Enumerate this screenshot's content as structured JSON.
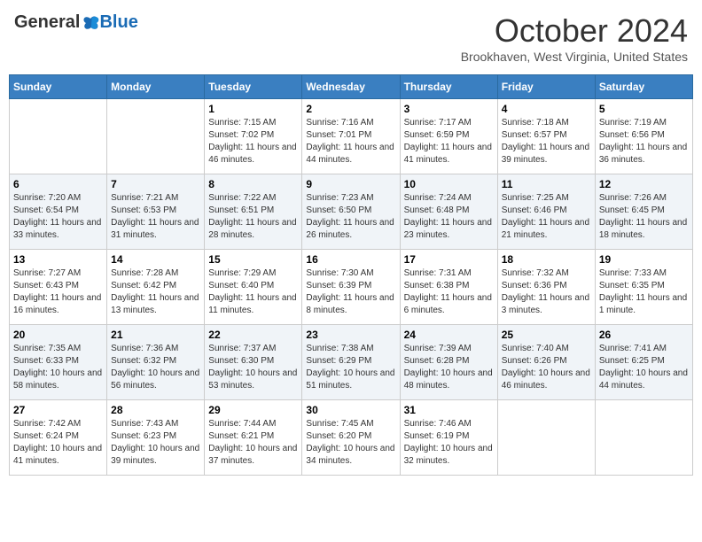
{
  "header": {
    "logo_general": "General",
    "logo_blue": "Blue",
    "month_title": "October 2024",
    "location": "Brookhaven, West Virginia, United States"
  },
  "days_of_week": [
    "Sunday",
    "Monday",
    "Tuesday",
    "Wednesday",
    "Thursday",
    "Friday",
    "Saturday"
  ],
  "weeks": [
    [
      {
        "day": "",
        "info": ""
      },
      {
        "day": "",
        "info": ""
      },
      {
        "day": "1",
        "info": "Sunrise: 7:15 AM\nSunset: 7:02 PM\nDaylight: 11 hours and 46 minutes."
      },
      {
        "day": "2",
        "info": "Sunrise: 7:16 AM\nSunset: 7:01 PM\nDaylight: 11 hours and 44 minutes."
      },
      {
        "day": "3",
        "info": "Sunrise: 7:17 AM\nSunset: 6:59 PM\nDaylight: 11 hours and 41 minutes."
      },
      {
        "day": "4",
        "info": "Sunrise: 7:18 AM\nSunset: 6:57 PM\nDaylight: 11 hours and 39 minutes."
      },
      {
        "day": "5",
        "info": "Sunrise: 7:19 AM\nSunset: 6:56 PM\nDaylight: 11 hours and 36 minutes."
      }
    ],
    [
      {
        "day": "6",
        "info": "Sunrise: 7:20 AM\nSunset: 6:54 PM\nDaylight: 11 hours and 33 minutes."
      },
      {
        "day": "7",
        "info": "Sunrise: 7:21 AM\nSunset: 6:53 PM\nDaylight: 11 hours and 31 minutes."
      },
      {
        "day": "8",
        "info": "Sunrise: 7:22 AM\nSunset: 6:51 PM\nDaylight: 11 hours and 28 minutes."
      },
      {
        "day": "9",
        "info": "Sunrise: 7:23 AM\nSunset: 6:50 PM\nDaylight: 11 hours and 26 minutes."
      },
      {
        "day": "10",
        "info": "Sunrise: 7:24 AM\nSunset: 6:48 PM\nDaylight: 11 hours and 23 minutes."
      },
      {
        "day": "11",
        "info": "Sunrise: 7:25 AM\nSunset: 6:46 PM\nDaylight: 11 hours and 21 minutes."
      },
      {
        "day": "12",
        "info": "Sunrise: 7:26 AM\nSunset: 6:45 PM\nDaylight: 11 hours and 18 minutes."
      }
    ],
    [
      {
        "day": "13",
        "info": "Sunrise: 7:27 AM\nSunset: 6:43 PM\nDaylight: 11 hours and 16 minutes."
      },
      {
        "day": "14",
        "info": "Sunrise: 7:28 AM\nSunset: 6:42 PM\nDaylight: 11 hours and 13 minutes."
      },
      {
        "day": "15",
        "info": "Sunrise: 7:29 AM\nSunset: 6:40 PM\nDaylight: 11 hours and 11 minutes."
      },
      {
        "day": "16",
        "info": "Sunrise: 7:30 AM\nSunset: 6:39 PM\nDaylight: 11 hours and 8 minutes."
      },
      {
        "day": "17",
        "info": "Sunrise: 7:31 AM\nSunset: 6:38 PM\nDaylight: 11 hours and 6 minutes."
      },
      {
        "day": "18",
        "info": "Sunrise: 7:32 AM\nSunset: 6:36 PM\nDaylight: 11 hours and 3 minutes."
      },
      {
        "day": "19",
        "info": "Sunrise: 7:33 AM\nSunset: 6:35 PM\nDaylight: 11 hours and 1 minute."
      }
    ],
    [
      {
        "day": "20",
        "info": "Sunrise: 7:35 AM\nSunset: 6:33 PM\nDaylight: 10 hours and 58 minutes."
      },
      {
        "day": "21",
        "info": "Sunrise: 7:36 AM\nSunset: 6:32 PM\nDaylight: 10 hours and 56 minutes."
      },
      {
        "day": "22",
        "info": "Sunrise: 7:37 AM\nSunset: 6:30 PM\nDaylight: 10 hours and 53 minutes."
      },
      {
        "day": "23",
        "info": "Sunrise: 7:38 AM\nSunset: 6:29 PM\nDaylight: 10 hours and 51 minutes."
      },
      {
        "day": "24",
        "info": "Sunrise: 7:39 AM\nSunset: 6:28 PM\nDaylight: 10 hours and 48 minutes."
      },
      {
        "day": "25",
        "info": "Sunrise: 7:40 AM\nSunset: 6:26 PM\nDaylight: 10 hours and 46 minutes."
      },
      {
        "day": "26",
        "info": "Sunrise: 7:41 AM\nSunset: 6:25 PM\nDaylight: 10 hours and 44 minutes."
      }
    ],
    [
      {
        "day": "27",
        "info": "Sunrise: 7:42 AM\nSunset: 6:24 PM\nDaylight: 10 hours and 41 minutes."
      },
      {
        "day": "28",
        "info": "Sunrise: 7:43 AM\nSunset: 6:23 PM\nDaylight: 10 hours and 39 minutes."
      },
      {
        "day": "29",
        "info": "Sunrise: 7:44 AM\nSunset: 6:21 PM\nDaylight: 10 hours and 37 minutes."
      },
      {
        "day": "30",
        "info": "Sunrise: 7:45 AM\nSunset: 6:20 PM\nDaylight: 10 hours and 34 minutes."
      },
      {
        "day": "31",
        "info": "Sunrise: 7:46 AM\nSunset: 6:19 PM\nDaylight: 10 hours and 32 minutes."
      },
      {
        "day": "",
        "info": ""
      },
      {
        "day": "",
        "info": ""
      }
    ]
  ]
}
